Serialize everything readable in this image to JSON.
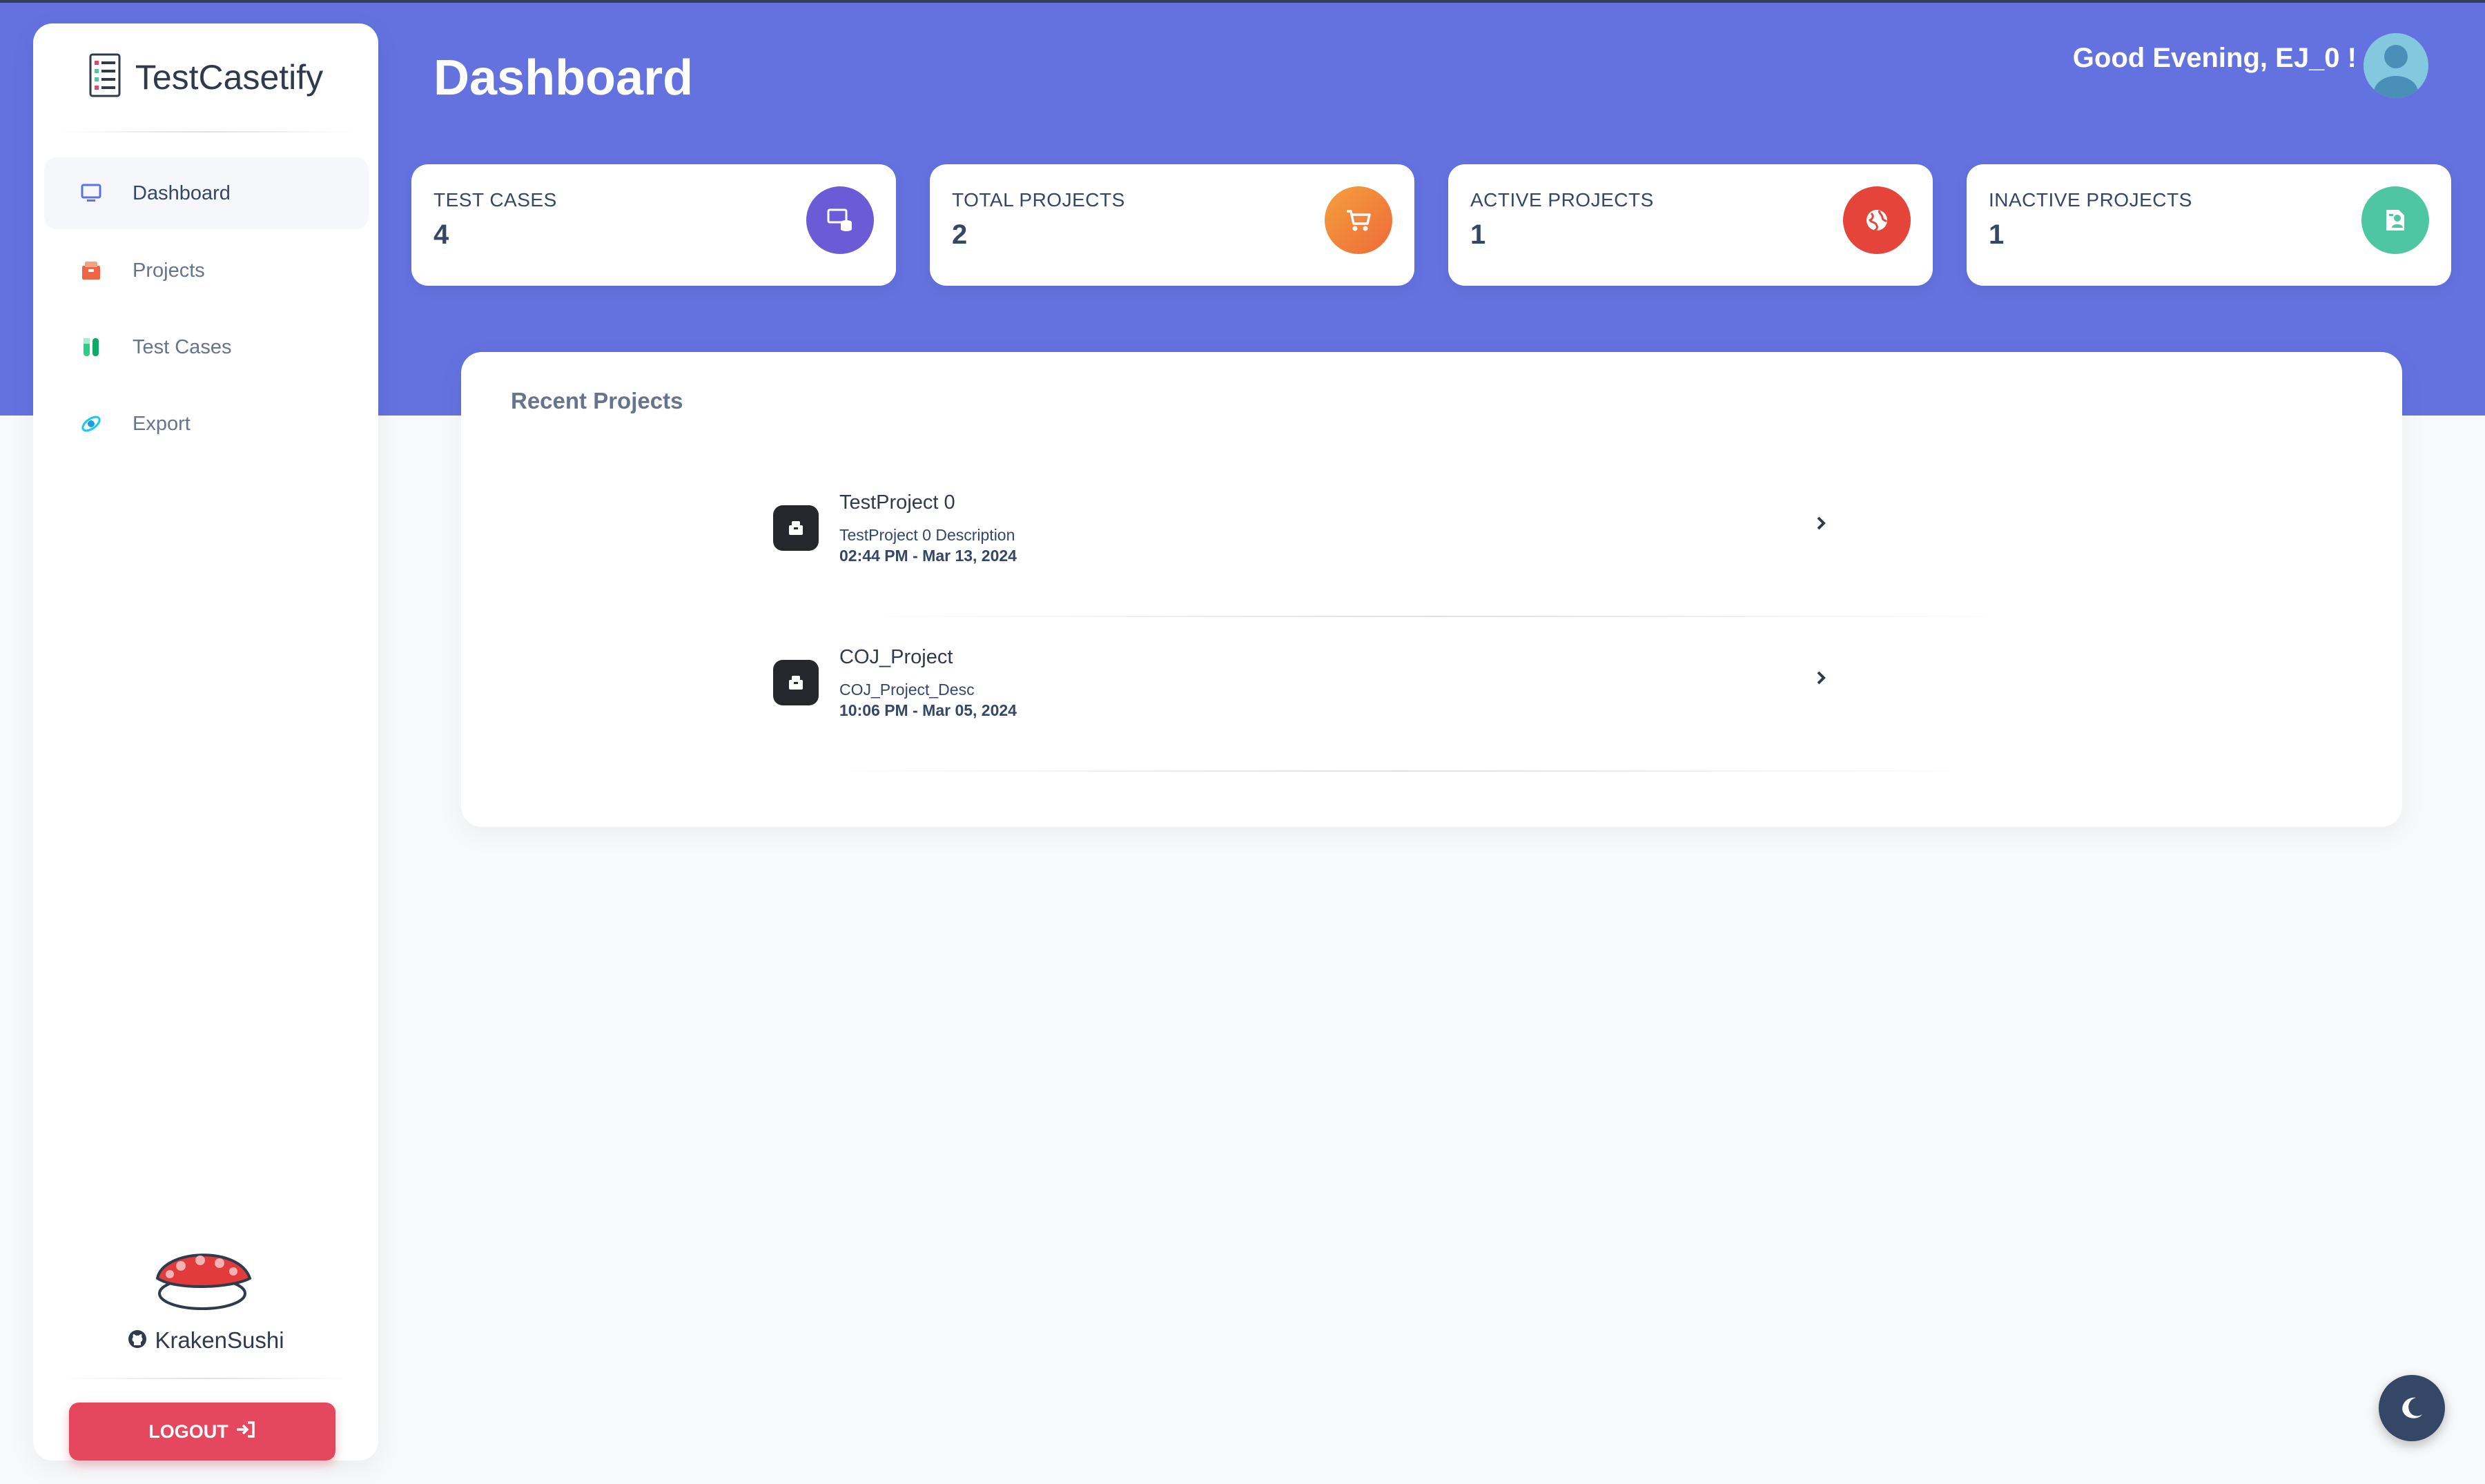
{
  "app": {
    "name": "TestCasetify"
  },
  "sidebar": {
    "items": [
      {
        "label": "Dashboard",
        "icon": "monitor-icon",
        "active": true
      },
      {
        "label": "Projects",
        "icon": "box-icon",
        "active": false
      },
      {
        "label": "Test Cases",
        "icon": "test-tubes-icon",
        "active": false
      },
      {
        "label": "Export",
        "icon": "rocket-icon",
        "active": false
      }
    ],
    "github_user": "KrakenSushi",
    "logout_label": "LOGOUT"
  },
  "header": {
    "title": "Dashboard",
    "greeting": "Good Evening, EJ_0 !"
  },
  "stats": [
    {
      "label": "TEST CASES",
      "value": "4",
      "icon": "database-screen-icon",
      "color": "#6c5bd6"
    },
    {
      "label": "TOTAL PROJECTS",
      "value": "2",
      "icon": "cart-icon",
      "color": "#f07b3a"
    },
    {
      "label": "ACTIVE PROJECTS",
      "value": "1",
      "icon": "globe-icon",
      "color": "#e5443a"
    },
    {
      "label": "INACTIVE PROJECTS",
      "value": "1",
      "icon": "badge-icon",
      "color": "#4fc6a3"
    }
  ],
  "recent": {
    "title": "Recent Projects",
    "projects": [
      {
        "name": "TestProject 0",
        "description": "TestProject 0 Description",
        "date": "02:44 PM - Mar 13, 2024"
      },
      {
        "name": "COJ_Project",
        "description": "COJ_Project_Desc",
        "date": "10:06 PM - Mar 05, 2024"
      }
    ]
  },
  "colors": {
    "hero": "#6472e0",
    "logout": "#e5475f",
    "theme_toggle": "#344767"
  },
  "theme_toggle_icon": "moon-icon"
}
